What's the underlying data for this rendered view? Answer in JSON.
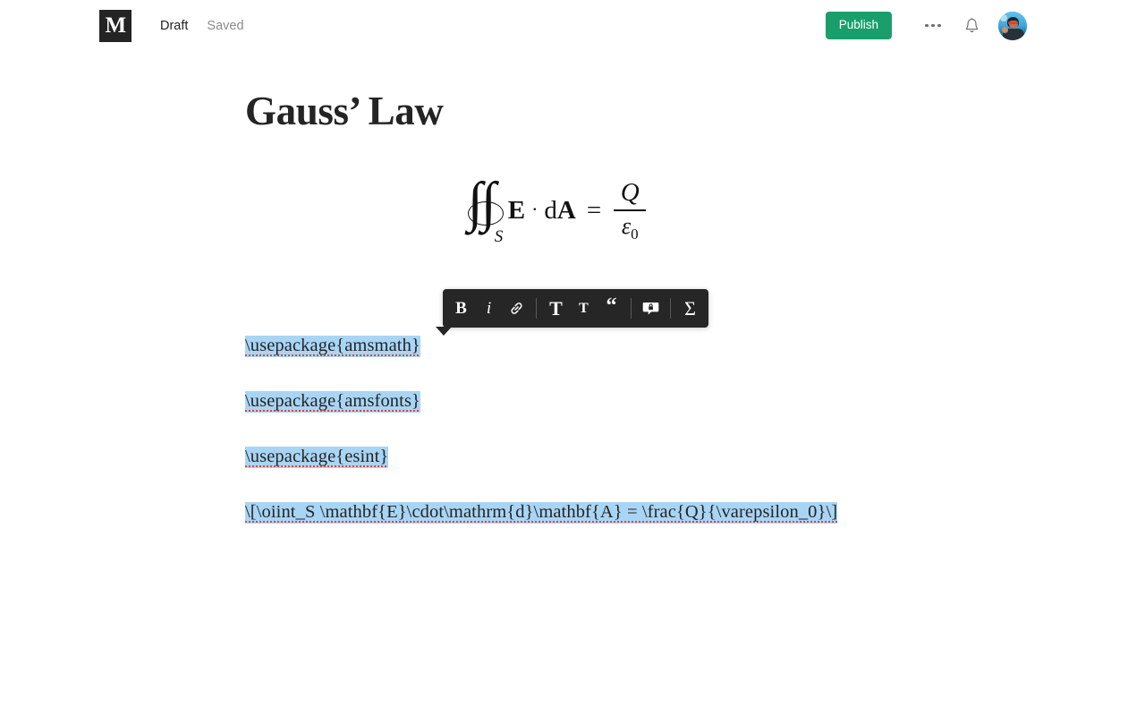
{
  "header": {
    "logo_letter": "M",
    "logo_name": "medium-logo",
    "draft_label": "Draft",
    "saved_label": "Saved",
    "publish_label": "Publish",
    "publish_color": "#1a9e6c",
    "more_options_name": "ellipsis-icon",
    "notifications_name": "bell-icon",
    "avatar_name": "user-avatar"
  },
  "article": {
    "title": "Gauss’ Law",
    "formula": {
      "latex": "\\oiint_S \\mathbf{E}\\cdot\\mathrm{d}\\mathbf{A} = \\frac{Q}{\\varepsilon_0}",
      "integral_subscript": "S",
      "vector_e": "E",
      "dot": "·",
      "differential": "d",
      "vector_a": "A",
      "equals": "=",
      "numerator": "Q",
      "denominator": "ε",
      "denominator_sub": "0"
    }
  },
  "toolbar": {
    "selection_color": "#a9d5f5",
    "background": "#262626",
    "items": [
      {
        "label": "B",
        "name": "bold-button"
      },
      {
        "label": "i",
        "name": "italic-button"
      },
      {
        "label": "",
        "name": "link-icon"
      },
      {
        "label": "T",
        "name": "heading-large-button"
      },
      {
        "label": "T",
        "name": "heading-small-button"
      },
      {
        "label": "“",
        "name": "blockquote-button"
      },
      {
        "label": "",
        "name": "private-note-icon"
      },
      {
        "label": "Σ",
        "name": "math-formula-button"
      }
    ]
  },
  "latex_source": {
    "lines": [
      "\\usepackage{amsmath}",
      "\\usepackage{amsfonts}",
      "\\usepackage{esint}",
      "\\[\\oiint_S \\mathbf{E}\\cdot\\mathrm{d}\\mathbf{A} = \\frac{Q}{\\varepsilon_0}\\]"
    ],
    "all_selected": true
  }
}
